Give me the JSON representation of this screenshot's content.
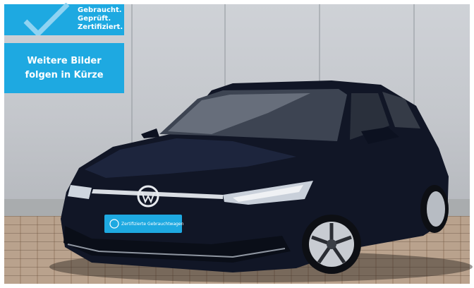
{
  "badge": {
    "lines": [
      "Gebraucht.",
      "Geprüft.",
      "Zertifiziert."
    ],
    "icon": "checkmark-icon",
    "color": "#1ea9e1"
  },
  "notice": {
    "line1": "Weitere Bilder",
    "line2": "folgen in Kürze"
  },
  "plate": {
    "text": "Zertifizierte Gebrauchtwagen",
    "icon": "vw-logo-icon"
  },
  "vehicle": {
    "body_color": "#0f1424",
    "brand_logo": "vw-logo-icon"
  }
}
